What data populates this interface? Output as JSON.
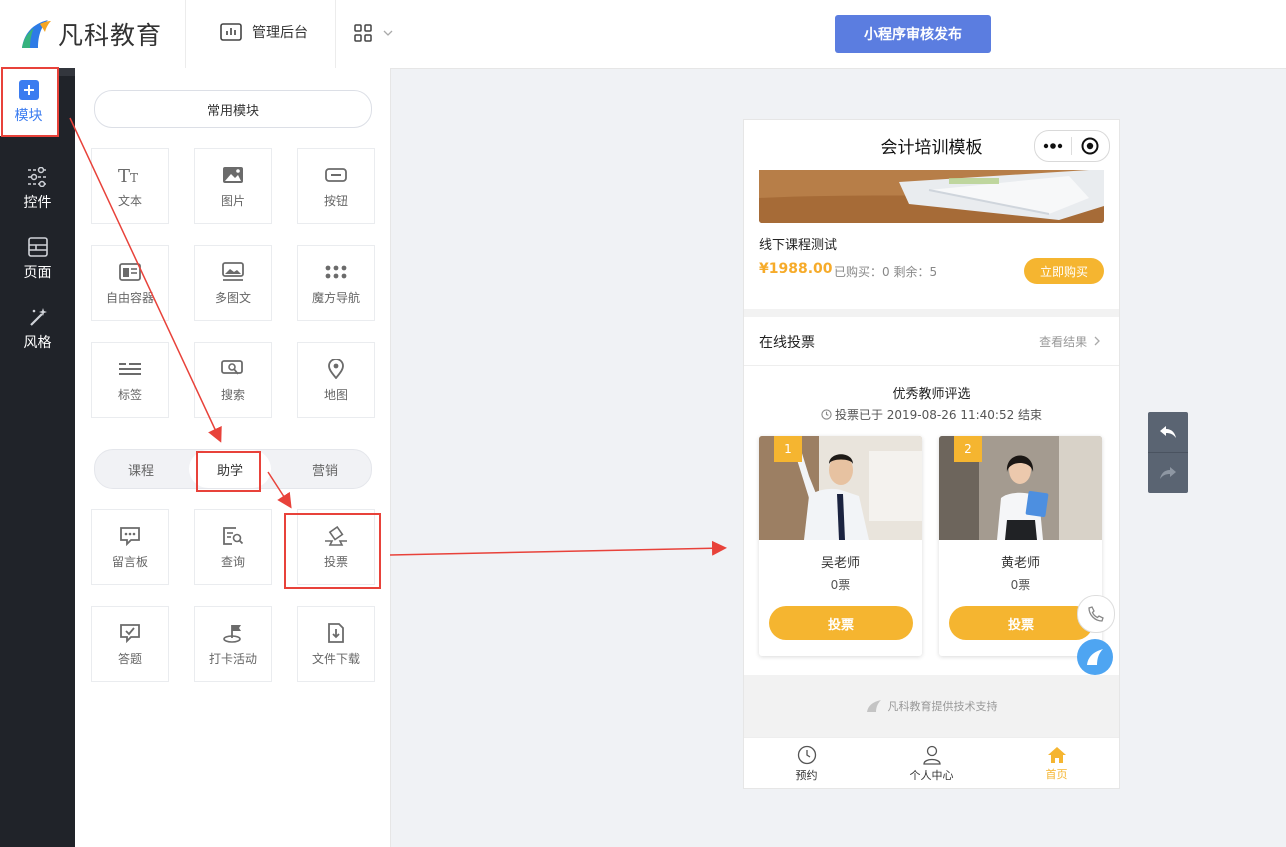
{
  "header": {
    "logo_text": "凡科教育",
    "admin_label": "管理后台",
    "publish_label": "小程序审核发布"
  },
  "sidenav": {
    "items": [
      {
        "label": "模块",
        "icon": "plus-square-icon"
      },
      {
        "label": "控件",
        "icon": "sliders-icon"
      },
      {
        "label": "页面",
        "icon": "page-icon"
      },
      {
        "label": "风格",
        "icon": "magic-wand-icon"
      }
    ]
  },
  "panel": {
    "common_title": "常用模块",
    "common_modules": [
      "文本",
      "图片",
      "按钮",
      "自由容器",
      "多图文",
      "魔方导航",
      "标签",
      "搜索",
      "地图"
    ],
    "tabs": [
      "课程",
      "助学",
      "营销"
    ],
    "active_tab": "助学",
    "study_modules": [
      "留言板",
      "查询",
      "投票",
      "答题",
      "打卡活动",
      "文件下载"
    ]
  },
  "preview": {
    "title": "会计培训模板",
    "course": {
      "title": "线下课程测试",
      "price": "¥1988.00",
      "sales": "已购买：0 剩余：5",
      "buy_label": "立即购买"
    },
    "vote": {
      "section_title": "在线投票",
      "result_link": "查看结果",
      "name": "优秀教师评选",
      "time": "投票已于 2019-08-26 11:40:52 结束",
      "candidates": [
        {
          "rank": "1",
          "name": "吴老师",
          "count": "0票",
          "button": "投票"
        },
        {
          "rank": "2",
          "name": "黄老师",
          "count": "0票",
          "button": "投票"
        }
      ]
    },
    "support": "凡科教育提供技术支持",
    "tabbar": [
      {
        "label": "预约",
        "icon": "clock-icon"
      },
      {
        "label": "个人中心",
        "icon": "user-icon"
      },
      {
        "label": "首页",
        "icon": "home-icon",
        "active": true
      }
    ]
  },
  "colors": {
    "accent": "#5b7de0",
    "orange": "#f5b530",
    "annotation_red": "#e8423a",
    "sidebar": "#202329"
  }
}
